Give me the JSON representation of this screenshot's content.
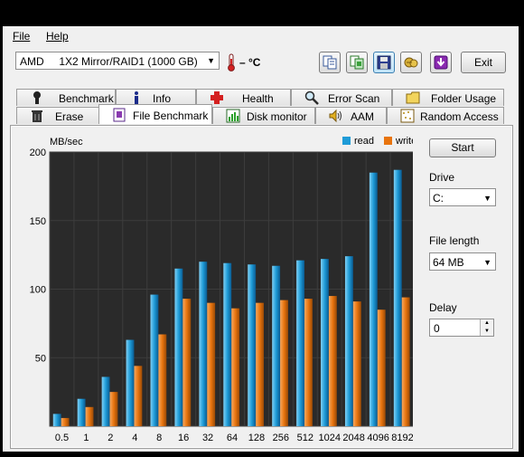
{
  "menu": {
    "file_label": "File",
    "help_label": "Help"
  },
  "toolbar": {
    "drive_value": "AMD     1X2 Mirror/RAID1 (1000 GB)",
    "temperature": "– °C",
    "icons": [
      "copy-icon",
      "copy-screenshot-icon",
      "save-icon",
      "health-options-icon",
      "download-icon"
    ],
    "exit_label": "Exit"
  },
  "tabs_row1": [
    {
      "label": "Benchmark",
      "icon": "benchmark-icon"
    },
    {
      "label": "Info",
      "icon": "info-icon"
    },
    {
      "label": "Health",
      "icon": "health-icon"
    },
    {
      "label": "Error Scan",
      "icon": "error-scan-icon"
    },
    {
      "label": "Folder Usage",
      "icon": "folder-icon"
    }
  ],
  "tabs_row2": [
    {
      "label": "Erase",
      "icon": "trash-icon"
    },
    {
      "label": "File Benchmark",
      "icon": "file-benchmark-icon",
      "active": true
    },
    {
      "label": "Disk monitor",
      "icon": "disk-monitor-icon"
    },
    {
      "label": "AAM",
      "icon": "speaker-icon"
    },
    {
      "label": "Random Access",
      "icon": "random-access-icon"
    }
  ],
  "side": {
    "start_label": "Start",
    "drive_label": "Drive",
    "drive_value": "C:",
    "file_length_label": "File length",
    "file_length_value": "64 MB",
    "delay_label": "Delay",
    "delay_value": "0"
  },
  "chart_data": {
    "type": "bar",
    "ylabel": "MB/sec",
    "ylim": [
      0,
      200
    ],
    "yticks": [
      50,
      100,
      150,
      200
    ],
    "categories": [
      "0.5",
      "1",
      "2",
      "4",
      "8",
      "16",
      "32",
      "64",
      "128",
      "256",
      "512",
      "1024",
      "2048",
      "4096",
      "8192"
    ],
    "series": [
      {
        "name": "read",
        "color": "#1e9bd7",
        "values": [
          9,
          20,
          36,
          63,
          96,
          115,
          120,
          119,
          118,
          117,
          121,
          122,
          124,
          185,
          187
        ]
      },
      {
        "name": "write",
        "color": "#e8740e",
        "values": [
          6,
          14,
          25,
          44,
          67,
          93,
          90,
          86,
          90,
          92,
          93,
          95,
          91,
          85,
          94
        ]
      }
    ],
    "legend_position": "top-right",
    "grid": true
  }
}
